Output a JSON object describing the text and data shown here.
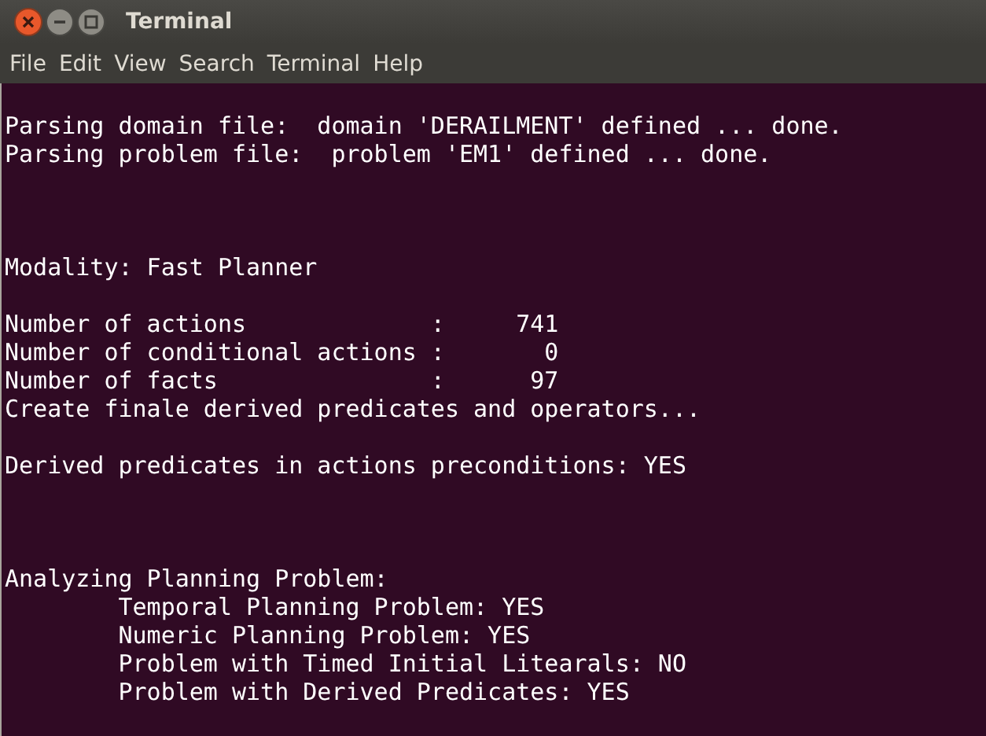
{
  "window": {
    "title": "Terminal"
  },
  "menu": [
    "File",
    "Edit",
    "View",
    "Search",
    "Terminal",
    "Help"
  ],
  "terminal": {
    "lines": [
      {
        "kind": "blank"
      },
      {
        "kind": "text",
        "text": "Parsing domain file:  domain 'DERAILMENT' defined ... done."
      },
      {
        "kind": "text",
        "text": "Parsing problem file:  problem 'EM1' defined ... done."
      },
      {
        "kind": "blank"
      },
      {
        "kind": "blank"
      },
      {
        "kind": "blank"
      },
      {
        "kind": "text",
        "text": "Modality: Fast Planner"
      },
      {
        "kind": "blank"
      },
      {
        "kind": "text",
        "text": "Number of actions             :     741"
      },
      {
        "kind": "text",
        "text": "Number of conditional actions :       0"
      },
      {
        "kind": "text",
        "text": "Number of facts               :      97"
      },
      {
        "kind": "text",
        "text": "Create finale derived predicates and operators..."
      },
      {
        "kind": "blank"
      },
      {
        "kind": "text",
        "text": "Derived predicates in actions preconditions: YES"
      },
      {
        "kind": "blank"
      },
      {
        "kind": "blank"
      },
      {
        "kind": "blank"
      },
      {
        "kind": "text",
        "text": "Analyzing Planning Problem:"
      },
      {
        "kind": "text",
        "text": "        Temporal Planning Problem: YES"
      },
      {
        "kind": "text",
        "text": "        Numeric Planning Problem: YES"
      },
      {
        "kind": "text",
        "text": "        Problem with Timed Initial Litearals: NO"
      },
      {
        "kind": "text",
        "text": "        Problem with Derived Predicates: YES"
      }
    ]
  }
}
